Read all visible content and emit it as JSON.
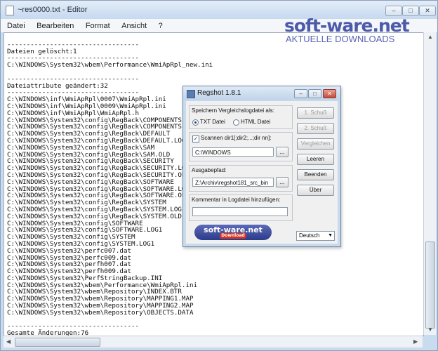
{
  "window": {
    "title": "~res0000.txt - Editor",
    "controls": [
      "–",
      "□",
      "✕"
    ]
  },
  "menu": [
    "Datei",
    "Bearbeiten",
    "Format",
    "Ansicht",
    "?"
  ],
  "content": {
    "lines": [
      "",
      "----------------------------------",
      "Dateien gelöscht:1",
      "----------------------------------",
      "C:\\WINDOWS\\System32\\wbem\\Performance\\WmiApRpl_new.ini",
      "",
      "----------------------------------",
      "Dateiattribute geändert:32",
      "----------------------------------",
      "C:\\WINDOWS\\inf\\WmiApRpl\\0007\\WmiApRpl.ini",
      "C:\\WINDOWS\\inf\\WmiApRpl\\0009\\WmiApRpl.ini",
      "C:\\WINDOWS\\inf\\WmiApRpl\\WmiApRpl.h",
      "C:\\WINDOWS\\System32\\config\\RegBack\\COMPONENTS",
      "C:\\WINDOWS\\System32\\config\\RegBack\\COMPONENTS.LOG1",
      "C:\\WINDOWS\\System32\\config\\RegBack\\DEFAULT",
      "C:\\WINDOWS\\System32\\config\\RegBack\\DEFAULT.LOG1",
      "C:\\WINDOWS\\System32\\config\\RegBack\\SAM",
      "C:\\WINDOWS\\System32\\config\\RegBack\\SAM.OLD",
      "C:\\WINDOWS\\System32\\config\\RegBack\\SECURITY",
      "C:\\WINDOWS\\System32\\config\\RegBack\\SECURITY.LOG1",
      "C:\\WINDOWS\\System32\\config\\RegBack\\SECURITY.OLD",
      "C:\\WINDOWS\\System32\\config\\RegBack\\SOFTWARE",
      "C:\\WINDOWS\\System32\\config\\RegBack\\SOFTWARE.LOG1",
      "C:\\WINDOWS\\System32\\config\\RegBack\\SOFTWARE.OLD",
      "C:\\WINDOWS\\System32\\config\\RegBack\\SYSTEM",
      "C:\\WINDOWS\\System32\\config\\RegBack\\SYSTEM.LOG1",
      "C:\\WINDOWS\\System32\\config\\RegBack\\SYSTEM.OLD",
      "C:\\WINDOWS\\System32\\config\\SOFTWARE",
      "C:\\WINDOWS\\System32\\config\\SOFTWARE.LOG1",
      "C:\\WINDOWS\\System32\\config\\SYSTEM",
      "C:\\WINDOWS\\System32\\config\\SYSTEM.LOG1",
      "C:\\WINDOWS\\System32\\perfc007.dat",
      "C:\\WINDOWS\\System32\\perfc009.dat",
      "C:\\WINDOWS\\System32\\perfh007.dat",
      "C:\\WINDOWS\\System32\\perfh009.dat",
      "C:\\WINDOWS\\System32\\PerfStringBackup.INI",
      "C:\\WINDOWS\\System32\\wbem\\Performance\\WmiApRpl.ini",
      "C:\\WINDOWS\\System32\\wbem\\Repository\\INDEX.BTR",
      "C:\\WINDOWS\\System32\\wbem\\Repository\\MAPPING1.MAP",
      "C:\\WINDOWS\\System32\\wbem\\Repository\\MAPPING2.MAP",
      "C:\\WINDOWS\\System32\\wbem\\Repository\\OBJECTS.DATA",
      "",
      "----------------------------------",
      "Gesamte Änderungen:76",
      "----------------------------------"
    ]
  },
  "watermark": {
    "main": "soft-ware.net",
    "sub": "AKTUELLE DOWNLOADS"
  },
  "regshot": {
    "title": "Regshot 1.8.1",
    "controls": [
      "–",
      "□",
      "✕"
    ],
    "save_group_label": "Speichern Vergleichslogdatei als:",
    "txt_label": "TXT Datei",
    "html_label": "HTML Datei",
    "txt_selected": true,
    "scan_label": "Scannen dir1[;dir2;...;dir nn]:",
    "scan_checked": true,
    "scan_value": "C:\\WINDOWS",
    "browse_label": "...",
    "output_label": "Ausgabepfad:",
    "output_value": "Z:\\Archiv\\regshot181_src_bin",
    "comment_label": "Kommentar in Logdatei hinzufügen:",
    "comment_value": "",
    "buttons": {
      "shot1": "1. Schuß",
      "shot2": "2. Schuß",
      "compare": "Vergleichen",
      "clear": "Leeren",
      "quit": "Beenden",
      "about": "Über"
    },
    "language": "Deutsch",
    "logo_main": "soft-ware.net",
    "logo_sub": "Download"
  }
}
